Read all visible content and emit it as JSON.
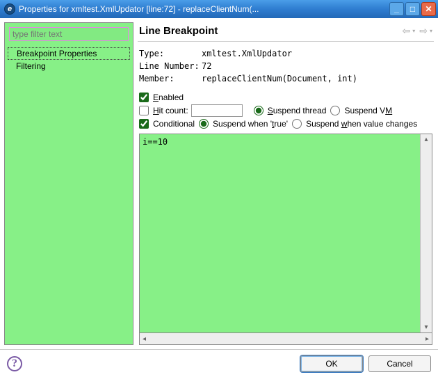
{
  "titlebar": {
    "text": "Properties for xmltest.XmlUpdator [line:72] - replaceClientNum(..."
  },
  "sidebar": {
    "filter_placeholder": "type filter text",
    "items": [
      {
        "label": "Breakpoint Properties",
        "selected": true
      },
      {
        "label": "Filtering",
        "selected": false
      }
    ]
  },
  "panel": {
    "title": "Line Breakpoint",
    "type_label": "Type:",
    "type_value": "xmltest.XmlUpdator",
    "line_label": "Line Number:",
    "line_value": "72",
    "member_label": "Member:",
    "member_value": "replaceClientNum(Document, int)"
  },
  "options": {
    "enabled_label_pre": "",
    "enabled_label_u": "E",
    "enabled_label_post": "nabled",
    "enabled_checked": true,
    "hitcount_label_u": "H",
    "hitcount_label_post": "it count:",
    "hitcount_checked": false,
    "hitcount_value": "",
    "suspend_thread_u": "S",
    "suspend_thread_post": "uspend thread",
    "suspend_vm_pre": "Suspend V",
    "suspend_vm_u": "M",
    "conditional_label": "Conditional",
    "conditional_checked": true,
    "suspend_when_true_pre": "Suspend when '",
    "suspend_when_true_u": "t",
    "suspend_when_true_post": "rue'",
    "suspend_when_changes_pre": "Suspend ",
    "suspend_when_changes_u": "w",
    "suspend_when_changes_post": "hen value changes",
    "suspend_mode": "true",
    "suspend_scope": "thread"
  },
  "editor": {
    "content": "i==10"
  },
  "buttons": {
    "ok": "OK",
    "cancel": "Cancel"
  }
}
